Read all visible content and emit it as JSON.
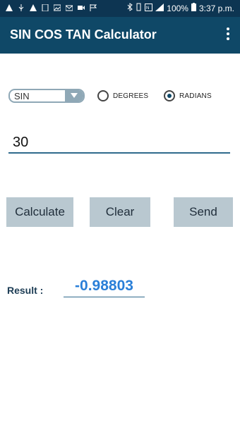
{
  "status_bar": {
    "battery": "100%",
    "time": "3:37 p.m."
  },
  "app": {
    "title": "SIN COS TAN Calculator"
  },
  "function_select": {
    "selected": "SIN"
  },
  "angle_mode": {
    "degrees_label": "DEGREES",
    "radians_label": "RADIANS",
    "selected": "RADIANS"
  },
  "angle_input": {
    "value": "30"
  },
  "buttons": {
    "calculate": "Calculate",
    "clear": "Clear",
    "send": "Send"
  },
  "result": {
    "label": "Result :",
    "value": "-0.98803"
  }
}
